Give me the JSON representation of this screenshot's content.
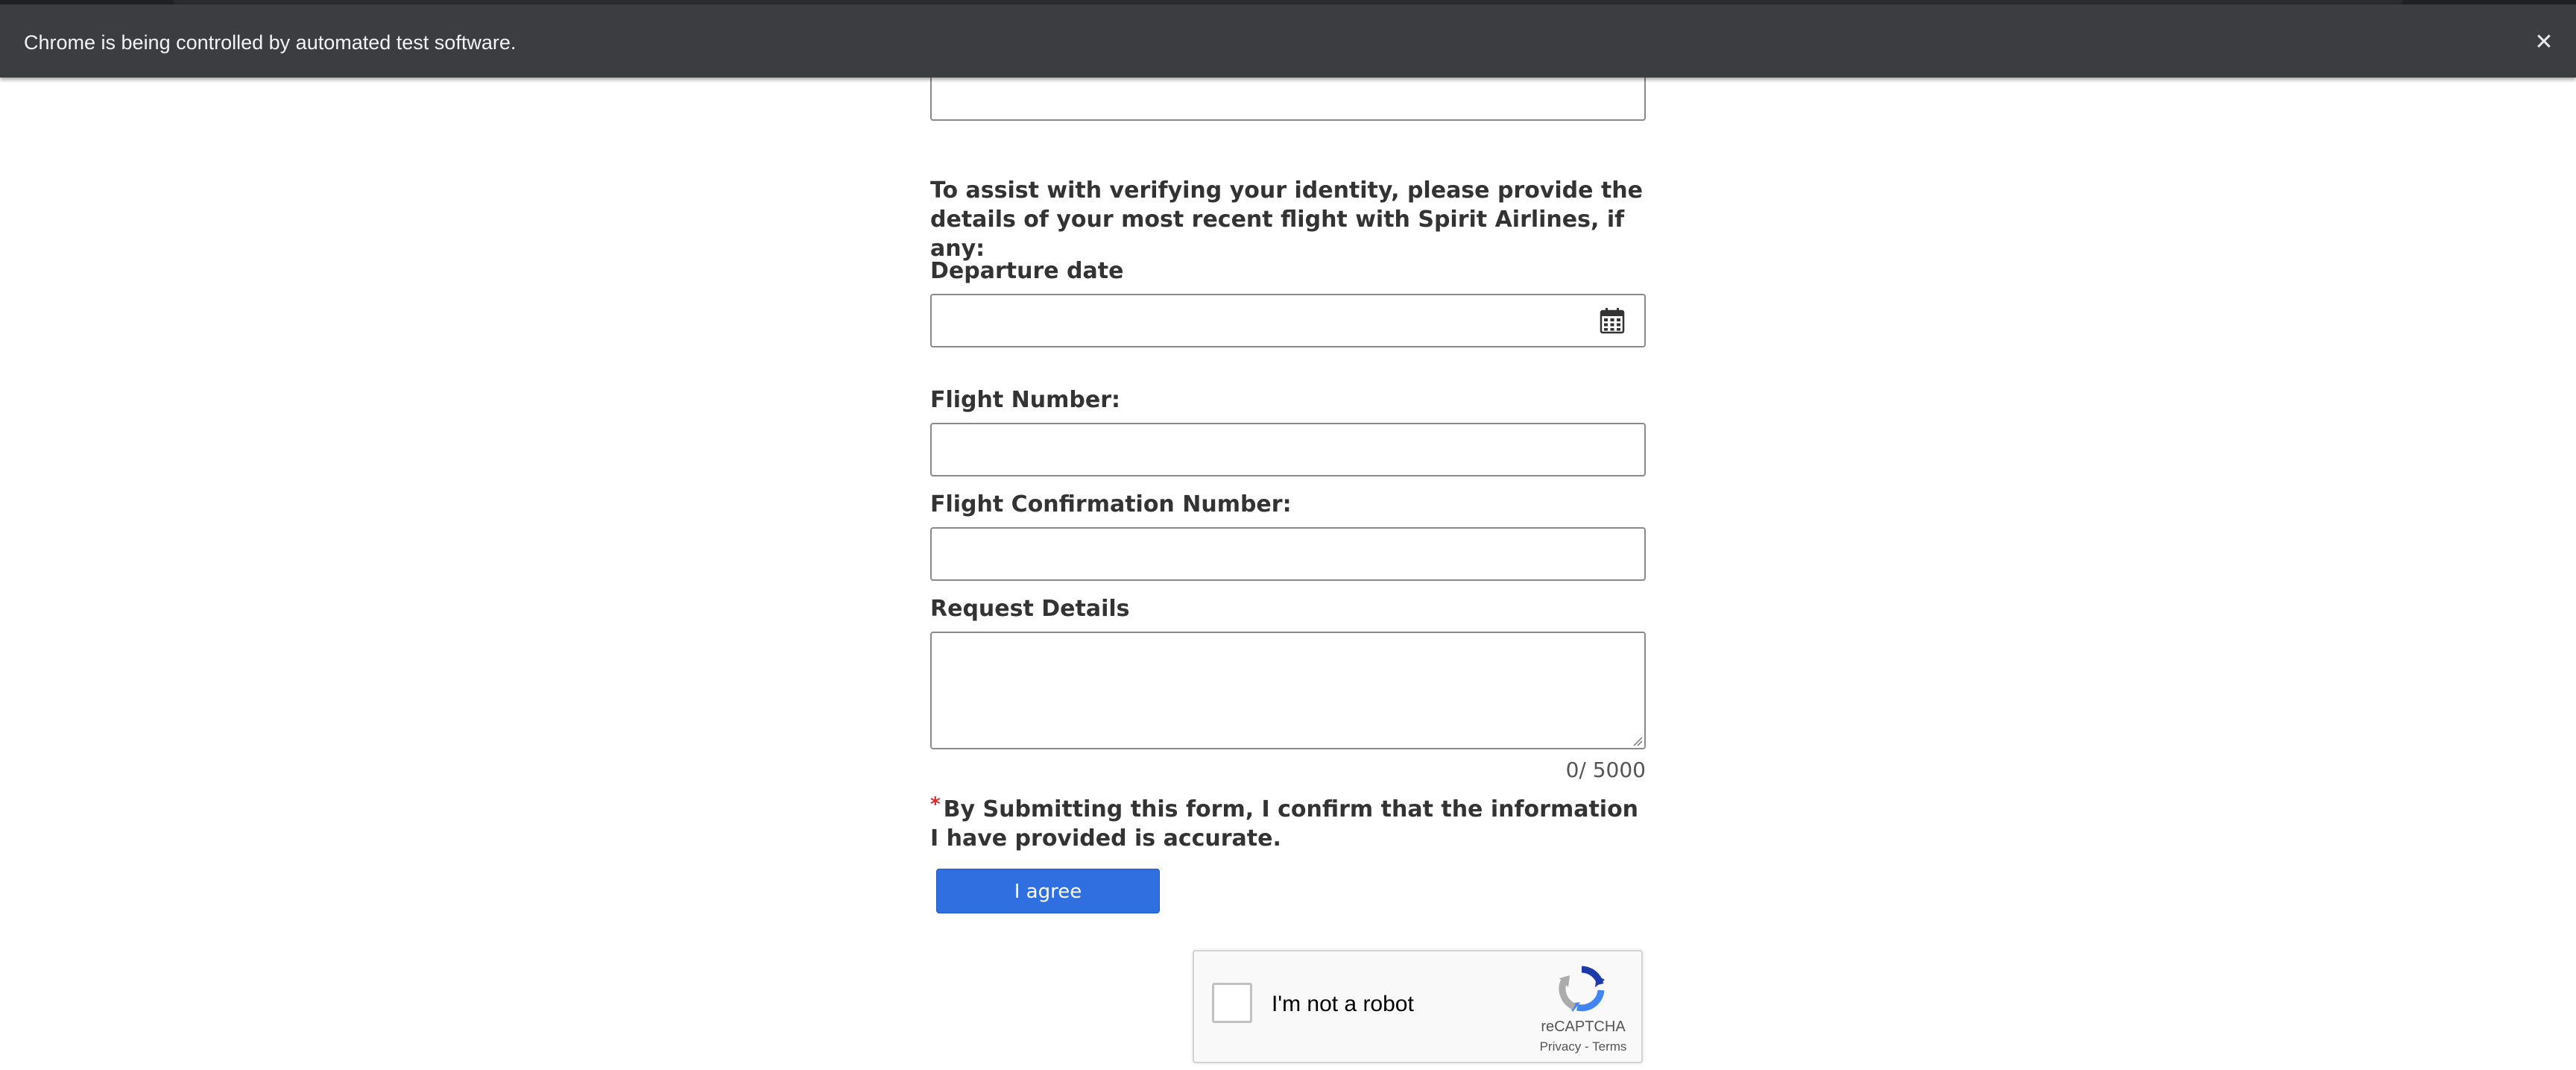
{
  "browser": {
    "infobar_text": "Chrome is being controlled by automated test software.",
    "close_icon": "close-icon"
  },
  "form": {
    "intro_text": "To assist with verifying your identity, please provide the details of your most recent flight with Spirit Airlines, if any:",
    "departure_date_label": "Departure date",
    "departure_date_value": "",
    "calendar_icon": "calendar-icon",
    "flight_number_label": "Flight Number:",
    "flight_number_value": "",
    "confirmation_number_label": "Flight Confirmation Number:",
    "confirmation_number_value": "",
    "request_details_label": "Request Details",
    "request_details_value": "",
    "char_counter": "0/ 5000",
    "required_marker": "*",
    "confirm_text": "By Submitting this form, I confirm that the information I have provided is accurate.",
    "agree_button_label": "I agree"
  },
  "recaptcha": {
    "checkbox_label": "I'm not a robot",
    "brand": "reCAPTCHA",
    "privacy_link": "Privacy",
    "separator": " - ",
    "terms_link": "Terms"
  },
  "colors": {
    "infobar_bg": "#3c3d40",
    "button_blue": "#2f6fe0",
    "required_red": "#d62b2b",
    "text_dark": "#333333"
  }
}
